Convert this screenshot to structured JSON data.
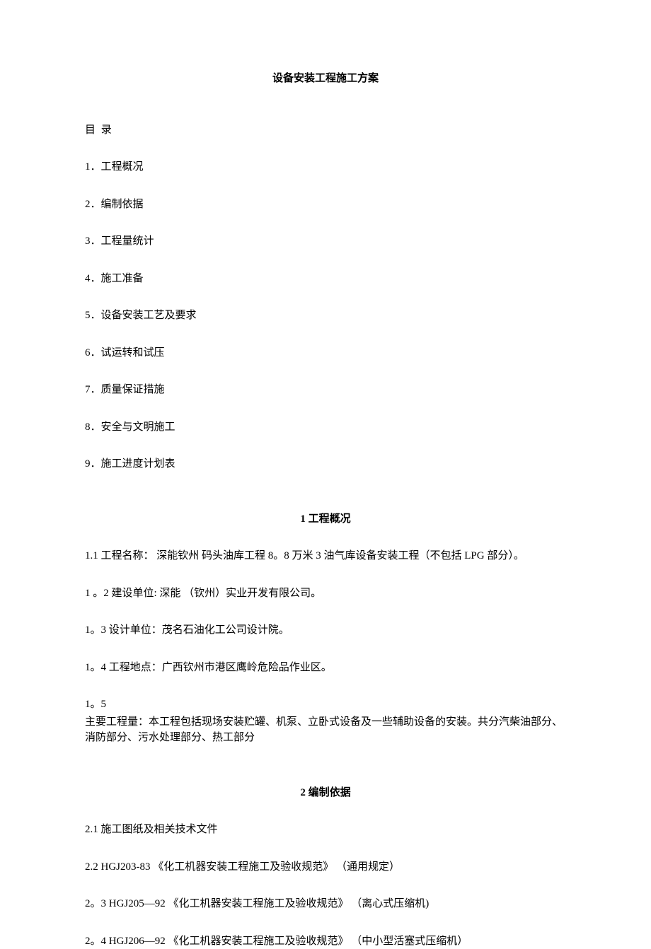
{
  "title": "设备安装工程施工方案",
  "toc": {
    "heading": "目 录",
    "items": [
      "1．工程概况",
      "2．编制依据",
      "3．工程量统计",
      "4．施工准备",
      "5．设备安装工艺及要求",
      "6．试运转和试压",
      "7．质量保证措施",
      "8．安全与文明施工",
      "9．施工进度计划表"
    ]
  },
  "section1": {
    "heading": "1 工程概况",
    "paras": [
      "1.1 工程名称： 深能钦州 码头油库工程 8。8 万米 3 油气库设备安装工程（不包括 LPG 部分）。",
      "1 。2 建设单位: 深能 （钦州）实业开发有限公司。",
      "1。3 设计单位：茂名石油化工公司设计院。",
      "1。4 工程地点：广西钦州市港区鹰岭危险品作业区。"
    ],
    "para5_lead": "1。5",
    "para5_body": "主要工程量：本工程包括现场安装贮罐、机泵、立卧式设备及一些辅助设备的安装。共分汽柴油部分、消防部分、污水处理部分、热工部分"
  },
  "section2": {
    "heading": "2 编制依据",
    "paras": [
      "2.1 施工图纸及相关技术文件",
      "2.2 HGJ203-83 《化工机器安装工程施工及验收规范》 （通用规定）",
      "2。3 HGJ205―92 《化工机器安装工程施工及验收规范》 （离心式压缩机)",
      "2。4 HGJ206―92 《化工机器安装工程施工及验收规范》 （中小型活塞式压缩机）"
    ]
  }
}
